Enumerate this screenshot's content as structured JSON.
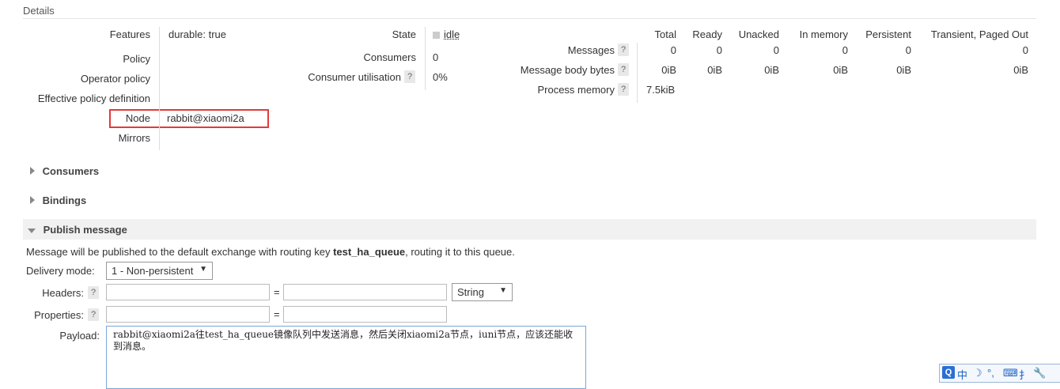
{
  "details": {
    "title": "Details",
    "left": {
      "features_label": "Features",
      "features_key": "durable:",
      "features_value": "true",
      "policy_label": "Policy",
      "operator_policy_label": "Operator policy",
      "effective_policy_label": "Effective policy definition",
      "node_label": "Node",
      "node_value": "rabbit@xiaomi2a",
      "mirrors_label": "Mirrors"
    },
    "middle": {
      "state_label": "State",
      "state_value": "idle",
      "consumers_label": "Consumers",
      "consumers_value": "0",
      "consumer_util_label": "Consumer utilisation",
      "consumer_util_value": "0%",
      "help": "?"
    },
    "stats": {
      "headers": [
        "Total",
        "Ready",
        "Unacked",
        "In memory",
        "Persistent",
        "Transient, Paged Out"
      ],
      "messages_label": "Messages",
      "messages_values": [
        "0",
        "0",
        "0",
        "0",
        "0",
        "0"
      ],
      "body_bytes_label": "Message body bytes",
      "body_bytes_values": [
        "0iB",
        "0iB",
        "0iB",
        "0iB",
        "0iB",
        "0iB"
      ],
      "process_memory_label": "Process memory",
      "process_memory_value": "7.5kiB"
    }
  },
  "sections": {
    "consumers": "Consumers",
    "bindings": "Bindings",
    "publish": "Publish message"
  },
  "publish": {
    "info_prefix": "Message will be published to the default exchange with routing key ",
    "routing_key": "test_ha_queue",
    "info_suffix": ", routing it to this queue.",
    "delivery_mode_label": "Delivery mode:",
    "delivery_mode_value": "1 - Non-persistent",
    "headers_label": "Headers:",
    "headers_type": "String",
    "properties_label": "Properties:",
    "equals": "=",
    "payload_label": "Payload:",
    "payload_text": "rabbit@xiaomi2a往test_ha_queue镜像队列中发送消息，然后关闭xiaomi2a节点，iuni节点，应该还能收到消息。"
  },
  "tray": {
    "items": [
      "中",
      "☽",
      "°,",
      "⌨",
      "扌",
      "🔧"
    ]
  }
}
